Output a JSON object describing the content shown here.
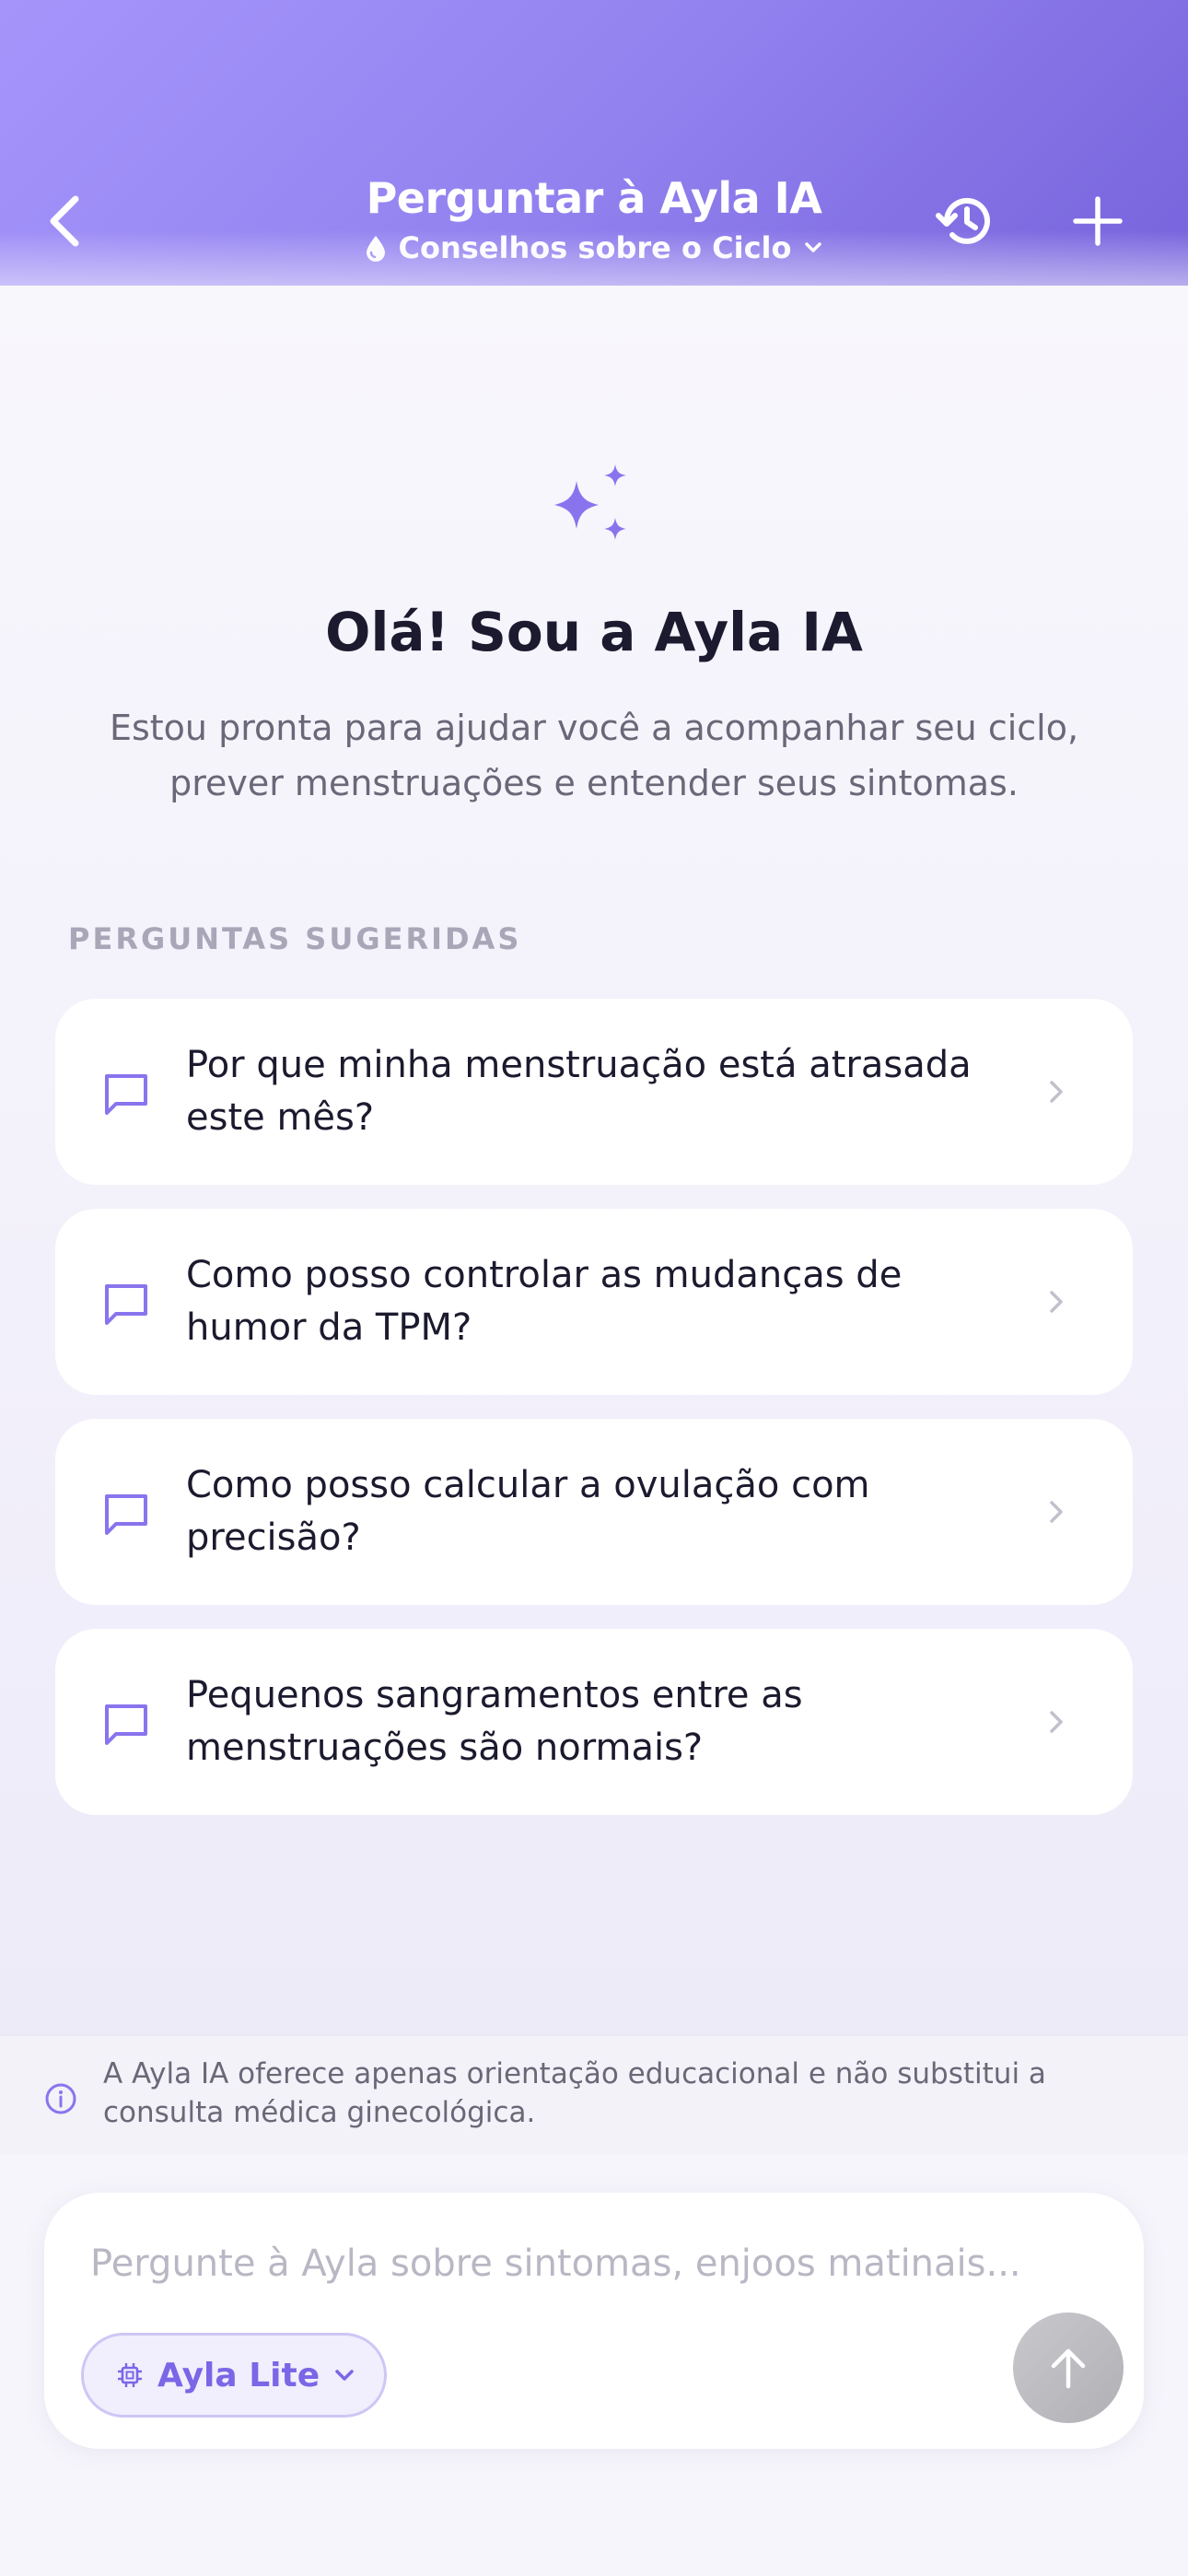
{
  "header": {
    "title": "Perguntar à Ayla IA",
    "subtitle": "Conselhos sobre o Ciclo",
    "back_icon": "chevron-left-icon",
    "history_icon": "history-icon",
    "new_icon": "plus-icon"
  },
  "intro": {
    "greeting": "Olá! Sou a Ayla IA",
    "description": "Estou pronta para ajudar você a acompanhar seu ciclo, prever menstruações e entender seus sintomas."
  },
  "suggestions": {
    "label": "PERGUNTAS SUGERIDAS",
    "items": [
      {
        "text": "Por que minha menstruação está atrasada este mês?"
      },
      {
        "text": "Como posso controlar as mudanças de humor da TPM?"
      },
      {
        "text": "Como posso calcular a ovulação com precisão?"
      },
      {
        "text": "Pequenos sangramentos entre as menstruações são normais?"
      }
    ]
  },
  "disclaimer": {
    "text": "A Ayla IA oferece apenas orientação educacional e não substitui a consulta médica ginecológica."
  },
  "composer": {
    "placeholder": "Pergunte à Ayla sobre sintomas, enjoos matinais...",
    "value": "",
    "model_label": "Ayla Lite"
  },
  "colors": {
    "accent": "#7a66e6",
    "header_start": "#a595fb",
    "header_end": "#7763dc",
    "text_primary": "#1b1a2e",
    "text_secondary": "#6a6878"
  }
}
